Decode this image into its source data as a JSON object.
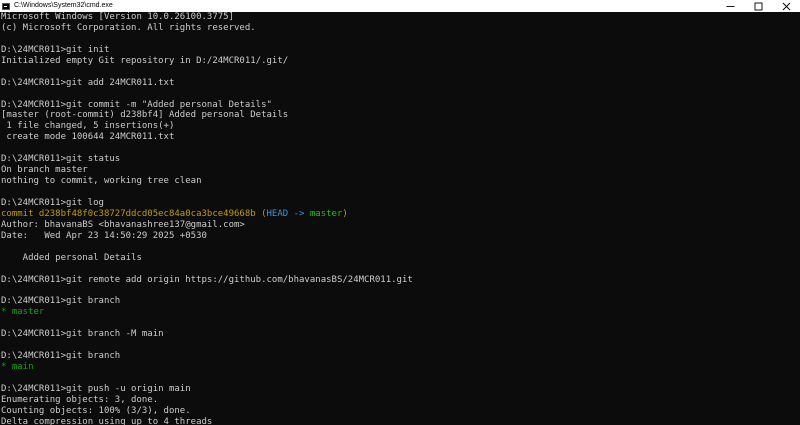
{
  "window": {
    "title": "C:\\Windows\\System32\\cmd.exe",
    "controls": [
      "minimize",
      "maximize",
      "close"
    ]
  },
  "console": {
    "lines": [
      {
        "text": "Microsoft Windows [Version 10.0.26100.3775]"
      },
      {
        "text": "(c) Microsoft Corporation. All rights reserved."
      },
      {
        "text": ""
      },
      {
        "text": "D:\\24MCR011>git init"
      },
      {
        "text": "Initialized empty Git repository in D:/24MCR011/.git/"
      },
      {
        "text": ""
      },
      {
        "text": "D:\\24MCR011>git add 24MCR011.txt"
      },
      {
        "text": ""
      },
      {
        "text": "D:\\24MCR011>git commit -m \"Added personal Details\""
      },
      {
        "text": "[master (root-commit) d238bf4] Added personal Details"
      },
      {
        "text": " 1 file changed, 5 insertions(+)"
      },
      {
        "text": " create mode 100644 24MCR011.txt"
      },
      {
        "text": ""
      },
      {
        "text": "D:\\24MCR011>git status"
      },
      {
        "text": "On branch master"
      },
      {
        "text": "nothing to commit, working tree clean"
      },
      {
        "text": ""
      },
      {
        "text": "D:\\24MCR011>git log"
      },
      {
        "segments": [
          {
            "text": "commit d238bf48f0c38727ddcd05ec84a0ca3bce49668b ",
            "color": "yellow"
          },
          {
            "text": "(",
            "color": "yellow"
          },
          {
            "text": "HEAD -> ",
            "color": "cyan"
          },
          {
            "text": "master",
            "color": "green"
          },
          {
            "text": ")",
            "color": "yellow"
          }
        ]
      },
      {
        "text": "Author: bhavanaBS <bhavanashree137@gmail.com>"
      },
      {
        "text": "Date:   Wed Apr 23 14:50:29 2025 +0530"
      },
      {
        "text": ""
      },
      {
        "text": "    Added personal Details"
      },
      {
        "text": ""
      },
      {
        "text": "D:\\24MCR011>git remote add origin https://github.com/bhavanasBS/24MCR011.git"
      },
      {
        "text": ""
      },
      {
        "text": "D:\\24MCR011>git branch"
      },
      {
        "segments": [
          {
            "text": "* master",
            "color": "green2"
          }
        ]
      },
      {
        "text": ""
      },
      {
        "text": "D:\\24MCR011>git branch -M main"
      },
      {
        "text": ""
      },
      {
        "text": "D:\\24MCR011>git branch"
      },
      {
        "segments": [
          {
            "text": "* main",
            "color": "green2"
          }
        ]
      },
      {
        "text": ""
      },
      {
        "text": "D:\\24MCR011>git push -u origin main"
      },
      {
        "text": "Enumerating objects: 3, done."
      },
      {
        "text": "Counting objects: 100% (3/3), done."
      },
      {
        "text": "Delta compression using up to 4 threads"
      }
    ]
  },
  "colors": {
    "background": "#0c0c0c",
    "foreground": "#cccccc",
    "yellow": "#c19c00",
    "cyan": "#3a96dd",
    "green": "#16c60c",
    "green2": "#13a10e"
  }
}
